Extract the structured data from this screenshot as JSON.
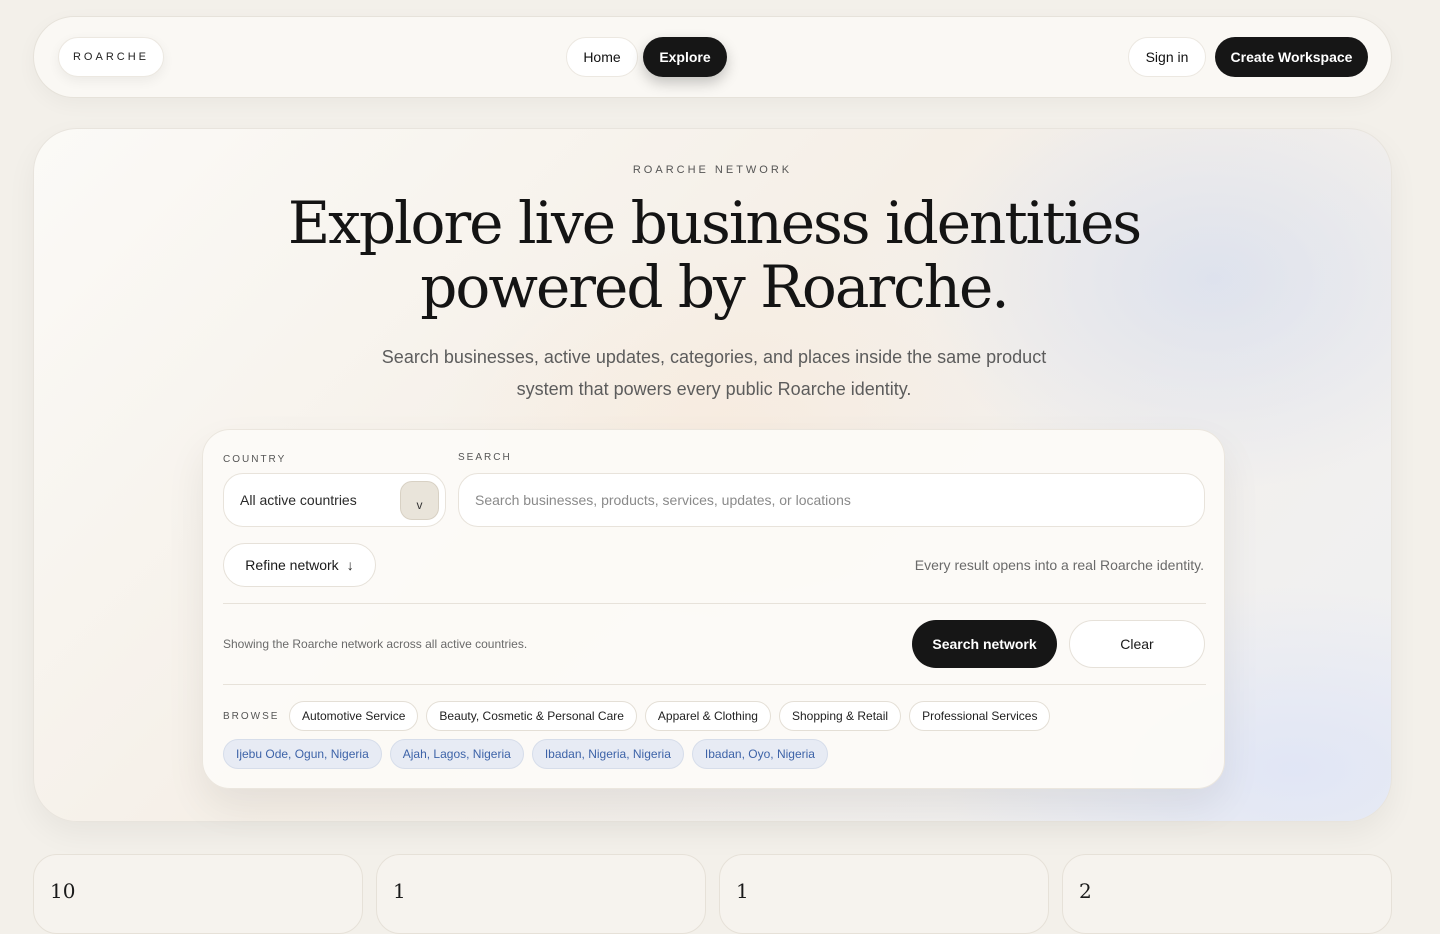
{
  "nav": {
    "logo": "ROARCHE",
    "home": "Home",
    "explore": "Explore",
    "sign_in": "Sign in",
    "create_workspace": "Create Workspace"
  },
  "hero": {
    "eyebrow": "ROARCHE NETWORK",
    "headline": "Explore live business identities powered by Roarche.",
    "subhead": "Search businesses, active updates, categories, and places inside the same product system that powers every public Roarche identity."
  },
  "search_panel": {
    "country_label": "COUNTRY",
    "country_value": "All active countries",
    "country_chevron": "v",
    "search_label": "SEARCH",
    "search_placeholder": "Search businesses, products, services, updates, or locations",
    "search_value": "",
    "refine_label": "Refine network",
    "refine_arrow": "↓",
    "hint": "Every result opens into a real Roarche identity.",
    "showing": "Showing the Roarche network across all active countries.",
    "search_button": "Search network",
    "clear_button": "Clear",
    "browse_label": "BROWSE",
    "categories": [
      "Automotive Service",
      "Beauty, Cosmetic & Personal Care",
      "Apparel & Clothing",
      "Shopping & Retail",
      "Professional Services"
    ],
    "locations": [
      "Ijebu Ode, Ogun, Nigeria",
      "Ajah, Lagos, Nigeria",
      "Ibadan, Nigeria, Nigeria",
      "Ibadan, Oyo, Nigeria"
    ]
  },
  "stats": [
    "10",
    "1",
    "1",
    "2"
  ]
}
